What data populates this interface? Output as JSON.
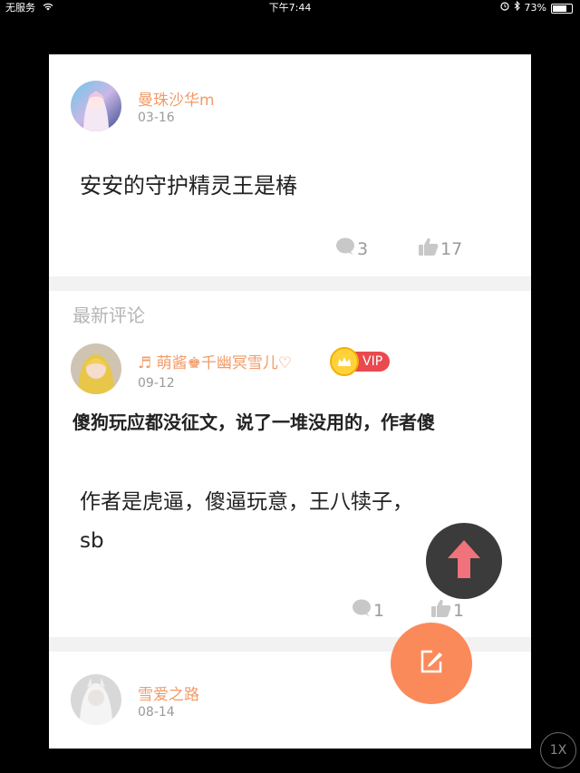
{
  "status_bar": {
    "carrier": "无服务",
    "time": "下午7:44",
    "battery": "73%"
  },
  "post": {
    "author": "曼珠沙华m",
    "date": "03-16",
    "content": "安安的守护精灵王是椿",
    "comment_count": "3",
    "like_count": "17"
  },
  "latest_comments": {
    "title": "最新评论",
    "items": [
      {
        "author": "♬ 萌酱♚千幽冥雪儿♡",
        "vip_label": "VIP",
        "date": "09-12",
        "headline": "傻狗玩应都没征文，说了一堆没用的，作者傻",
        "content_line1": "作者是虎逼，傻逼玩意，王八犊子，",
        "content_line2": "sb",
        "comment_count": "1",
        "like_count": "1"
      },
      {
        "author": "雪爱之路",
        "date": "08-14"
      }
    ]
  },
  "zoom_label": "1X",
  "colors": {
    "accent_orange": "#f29b67",
    "fab_orange": "#fb8a5b",
    "fab_arrow": "#f0727a",
    "vip_red": "#e9494f",
    "gray_text": "#9a9a9a"
  },
  "icons": [
    "wifi-icon",
    "comment-icon",
    "like-icon",
    "arrow-up-icon",
    "edit-icon",
    "crown-icon",
    "alarm-icon",
    "bluetooth-icon",
    "battery-icon"
  ]
}
